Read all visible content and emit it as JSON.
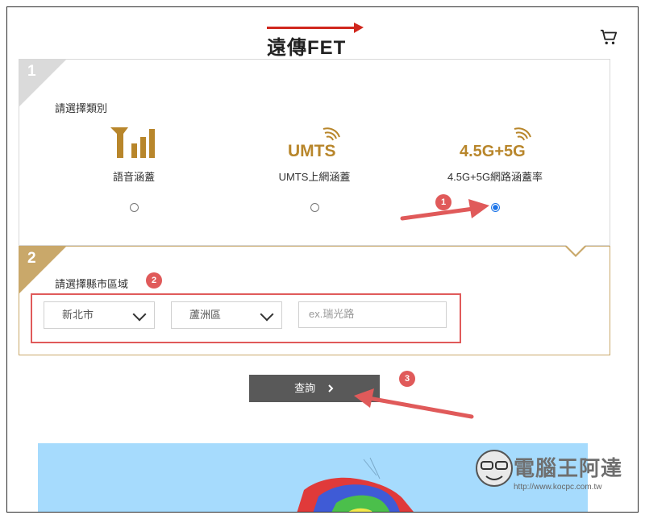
{
  "header": {
    "logo_text": "遠傳FET",
    "cart_icon": "shopping-cart-icon"
  },
  "step1": {
    "number": "1",
    "title": "請選擇類別",
    "options": [
      {
        "label": "語音涵蓋",
        "icon": "signal-bars-icon",
        "selected": false
      },
      {
        "label": "UMTS上網涵蓋",
        "icon_text": "UMTS",
        "selected": false
      },
      {
        "label": "4.5G+5G網路涵蓋率",
        "icon_text": "4.5G+5G",
        "selected": true
      }
    ]
  },
  "step2": {
    "number": "2",
    "title": "請選擇縣市區域",
    "city": "新北市",
    "district": "蘆洲區",
    "address_placeholder": "ex.瑞光路"
  },
  "query_label": "查詢",
  "annotations": [
    "1",
    "2",
    "3"
  ],
  "watermark": {
    "title": "電腦王阿達",
    "url": "http://www.kocpc.com.tw"
  },
  "colors": {
    "brand_red": "#d0271d",
    "gold": "#b8862b",
    "radio_blue": "#1a73e8",
    "annotation_red": "#e05a5a",
    "button_gray": "#595959"
  }
}
